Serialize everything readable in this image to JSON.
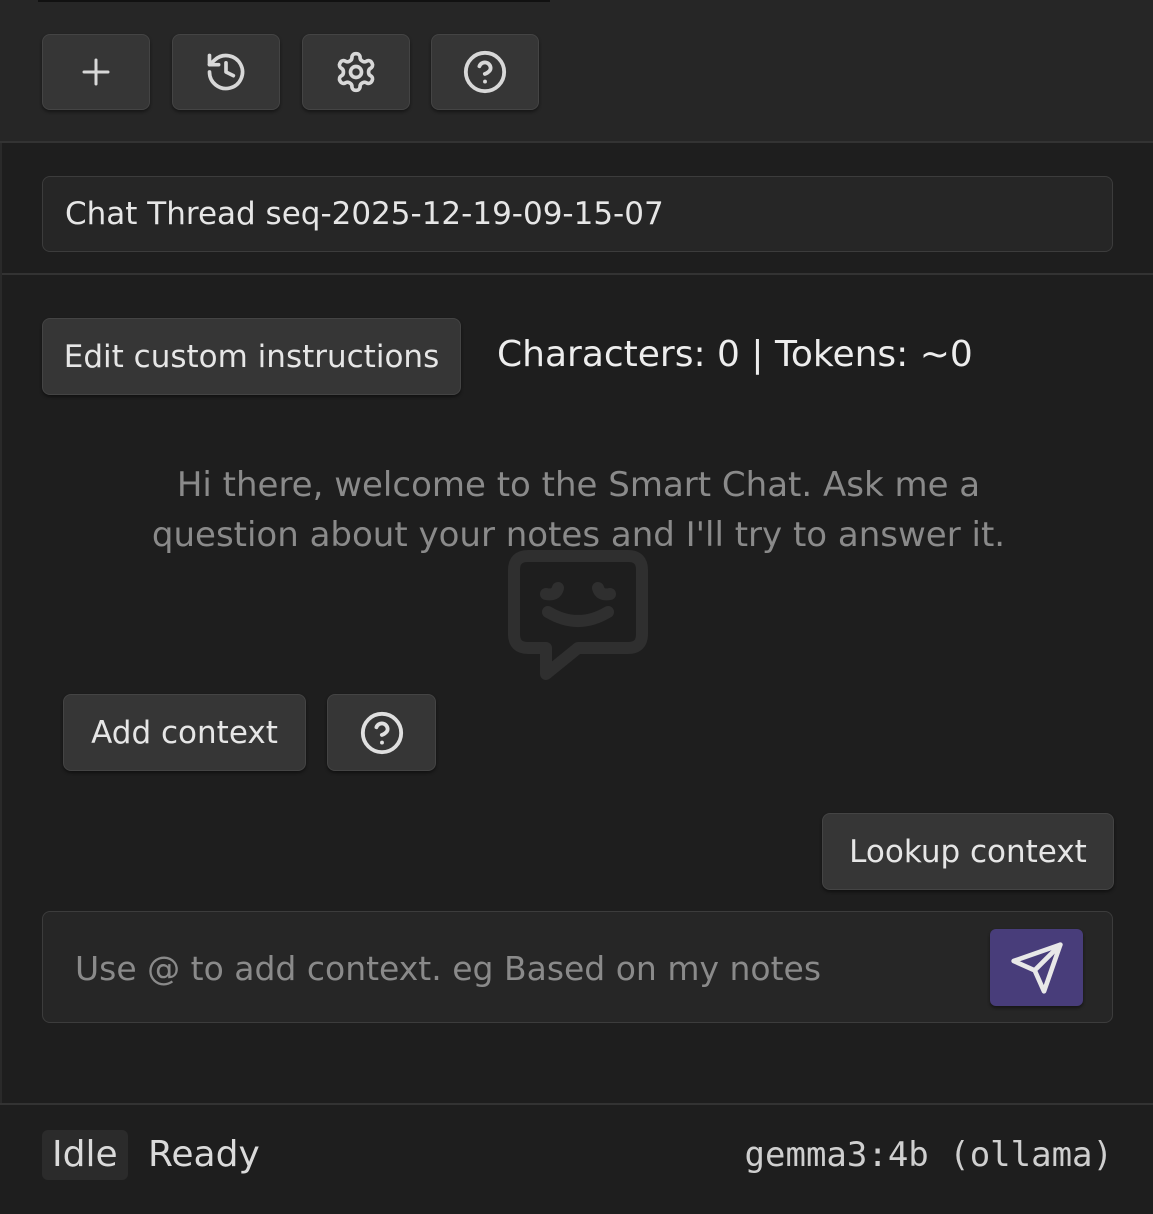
{
  "toolbar": {
    "buttons": [
      {
        "name": "new-chat-button",
        "icon": "plus-icon"
      },
      {
        "name": "history-button",
        "icon": "history-icon"
      },
      {
        "name": "settings-button",
        "icon": "gear-icon"
      },
      {
        "name": "help-button",
        "icon": "help-circle-icon"
      }
    ]
  },
  "thread": {
    "title": "Chat Thread seq-2025-12-19-09-15-07"
  },
  "instructions": {
    "edit_label": "Edit custom instructions",
    "counter_text": "Characters: 0 | Tokens: ~0"
  },
  "welcome": {
    "message": "Hi there, welcome to the Smart Chat. Ask me a question about your notes and I'll try to answer it.",
    "icon": "chat-smile-icon"
  },
  "context": {
    "add_label": "Add context",
    "help_icon": "help-circle-icon",
    "lookup_label": "Lookup context"
  },
  "composer": {
    "placeholder": "Use @ to add context. eg Based on my notes",
    "value": "",
    "send_icon": "send-icon"
  },
  "status": {
    "state": "Idle",
    "text": "Ready",
    "model": "gemma3:4b (ollama)"
  },
  "colors": {
    "background": "#1e1e1e",
    "panel": "#262626",
    "button": "#363636",
    "accent": "#483d7a",
    "muted_text": "#8a8a8a"
  }
}
